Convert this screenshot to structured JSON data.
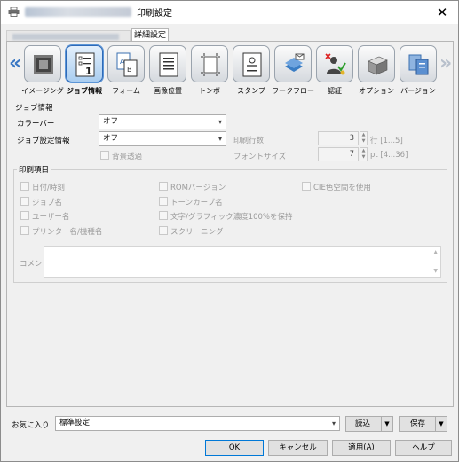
{
  "window": {
    "title": "印刷設定",
    "close_glyph": "✕",
    "tabs": [
      {
        "label": "",
        "active": false
      },
      {
        "label": "詳細設定",
        "active": true
      }
    ]
  },
  "nav": {
    "left_glyph": "«",
    "right_glyph": "»"
  },
  "toolbar": {
    "items": [
      {
        "label": "イメージング",
        "icon": "imaging-icon",
        "selected": false
      },
      {
        "label": "ジョブ情報",
        "icon": "job-info-icon",
        "selected": true
      },
      {
        "label": "フォーム",
        "icon": "form-icon",
        "selected": false
      },
      {
        "label": "画像位置",
        "icon": "image-position-icon",
        "selected": false
      },
      {
        "label": "トンボ",
        "icon": "crop-mark-icon",
        "selected": false
      },
      {
        "label": "スタンプ",
        "icon": "stamp-icon",
        "selected": false
      },
      {
        "label": "ワークフロー",
        "icon": "workflow-icon",
        "selected": false
      },
      {
        "label": "認証",
        "icon": "authentication-icon",
        "selected": false
      },
      {
        "label": "オプション",
        "icon": "option-icon",
        "selected": false
      },
      {
        "label": "バージョン",
        "icon": "version-icon",
        "selected": false
      }
    ]
  },
  "job_info": {
    "group_title": "ジョブ情報",
    "color_bar_label": "カラーバー",
    "color_bar_value": "オフ",
    "job_settings_label": "ジョブ設定情報",
    "job_settings_value": "オフ",
    "background_transparent_label": "背景透過",
    "print_lines_label": "印刷行数",
    "print_lines_value": "3",
    "print_lines_unit": "行 [1...5]",
    "font_size_label": "フォントサイズ",
    "font_size_value": "7",
    "font_size_unit": "pt [4...36]"
  },
  "print_items": {
    "group_title": "印刷項目",
    "checkboxes": [
      {
        "label": "日付/時刻",
        "checked": false
      },
      {
        "label": "ジョブ名",
        "checked": false
      },
      {
        "label": "ユーザー名",
        "checked": false
      },
      {
        "label": "プリンター名/機種名",
        "checked": false
      },
      {
        "label": "ROMバージョン",
        "checked": false
      },
      {
        "label": "トーンカーブ名",
        "checked": false
      },
      {
        "label": "文字/グラフィック濃度100%を保持",
        "checked": false
      },
      {
        "label": "スクリーニング",
        "checked": false
      },
      {
        "label": "CIE色空間を使用",
        "checked": false
      }
    ],
    "comment_label": "コメント",
    "comment_value": ""
  },
  "favorites": {
    "label": "お気に入り",
    "value": "標準設定",
    "load_label": "読込",
    "save_label": "保存"
  },
  "footer": {
    "ok_label": "OK",
    "cancel_label": "キャンセル",
    "apply_label": "適用(A)",
    "help_label": "ヘルプ"
  },
  "colors": {
    "accent": "#2e6ab8",
    "disabled_text": "#9a9a9a",
    "nav_arrow": "#3a78c4"
  }
}
